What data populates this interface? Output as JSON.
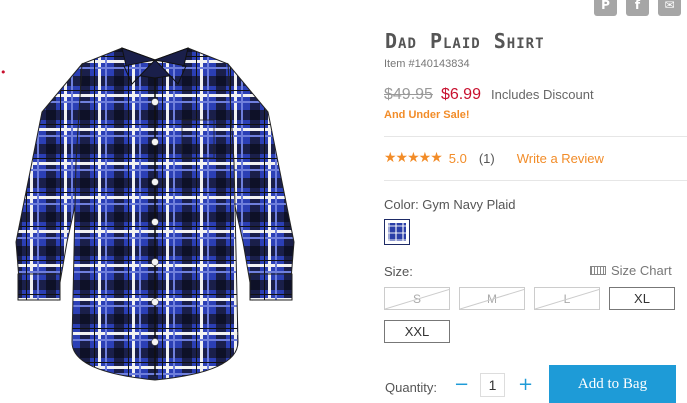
{
  "left_mark": "•",
  "share": {
    "pinterest": "P",
    "facebook": "f",
    "email": "✉"
  },
  "product": {
    "title": "Dad Plaid Shirt",
    "item_number": "Item #140143834",
    "price_original": "$49.95",
    "price_sale": "$6.99",
    "price_note": "Includes Discount",
    "sale_note": "And Under Sale!"
  },
  "rating": {
    "stars": "★★★★★",
    "value": "5.0",
    "count": "(1)",
    "review_link": "Write a Review"
  },
  "color": {
    "label": "Color: Gym Navy Plaid",
    "swatch_color": "#2a3ea8"
  },
  "size": {
    "label": "Size:",
    "chart_link": "Size Chart",
    "options": [
      {
        "label": "S",
        "available": false
      },
      {
        "label": "M",
        "available": false
      },
      {
        "label": "L",
        "available": false
      },
      {
        "label": "XL",
        "available": true
      },
      {
        "label": "XXL",
        "available": true
      }
    ]
  },
  "quantity": {
    "label": "Quantity:",
    "minus": "−",
    "plus": "+",
    "value": "1"
  },
  "add_to_bag": "Add to Bag",
  "colors": {
    "accent": "#1e9bd7",
    "sale": "#c8102e",
    "orange": "#f28c28"
  }
}
